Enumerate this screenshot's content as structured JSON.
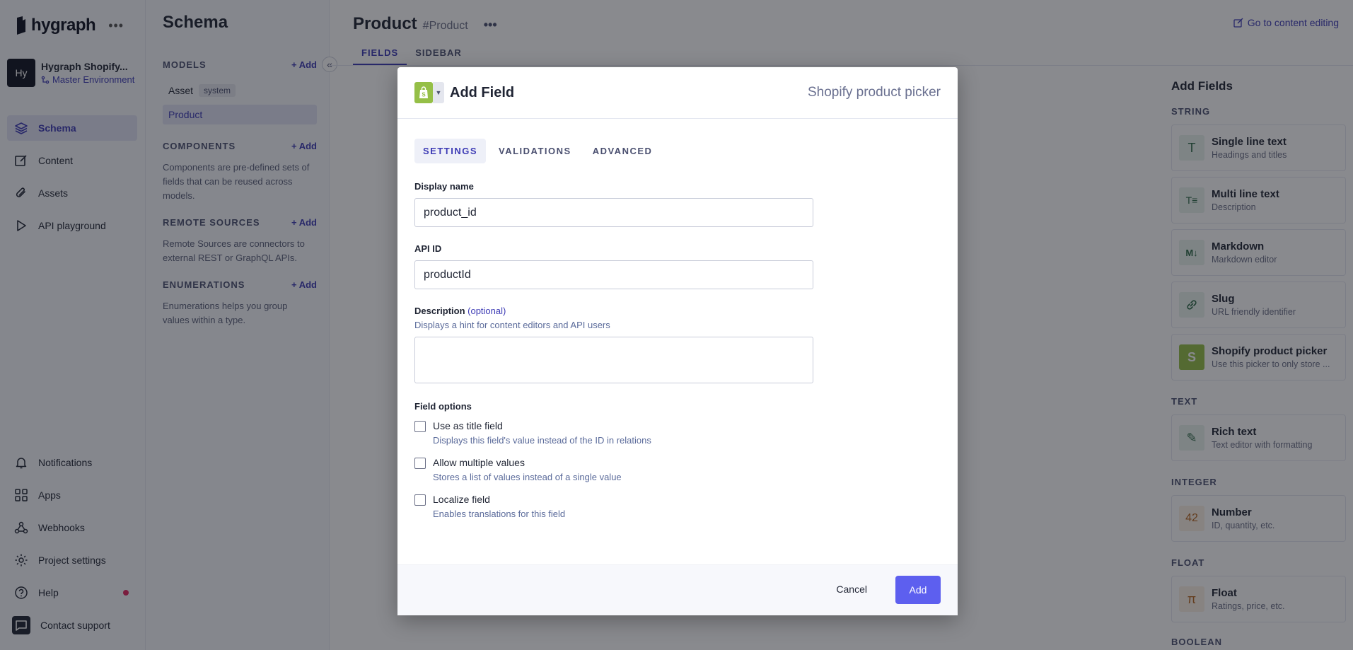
{
  "brand": {
    "name": "hygraph",
    "accent": "#3d3bb5",
    "primary_button": "#5d5fef"
  },
  "project": {
    "initials": "Hy",
    "name": "Hygraph Shopify...",
    "environment": "Master Environment"
  },
  "nav": {
    "primary": [
      {
        "label": "Schema",
        "icon": "layers-icon",
        "active": true
      },
      {
        "label": "Content",
        "icon": "edit-icon"
      },
      {
        "label": "Assets",
        "icon": "paperclip-icon"
      },
      {
        "label": "API playground",
        "icon": "play-icon"
      }
    ],
    "secondary": [
      {
        "label": "Notifications",
        "icon": "bell-icon"
      },
      {
        "label": "Apps",
        "icon": "apps-icon"
      },
      {
        "label": "Webhooks",
        "icon": "webhook-icon"
      },
      {
        "label": "Project settings",
        "icon": "gear-icon"
      },
      {
        "label": "Help",
        "icon": "help-icon"
      },
      {
        "label": "Contact support",
        "icon": "chat-icon"
      }
    ]
  },
  "schema": {
    "title": "Schema",
    "add_label": "Add",
    "models": {
      "heading": "MODELS",
      "asset": "Asset",
      "asset_badge": "system",
      "product": "Product"
    },
    "components": {
      "heading": "COMPONENTS",
      "desc": "Components are pre-defined sets of fields that can be reused across models."
    },
    "remote": {
      "heading": "REMOTE SOURCES",
      "desc": "Remote Sources are connectors to external REST or GraphQL APIs."
    },
    "enums": {
      "heading": "ENUMERATIONS",
      "desc": "Enumerations helps you group values within a type."
    }
  },
  "main": {
    "title": "Product",
    "api_id": "#Product",
    "content_link": "Go to content editing",
    "tabs": [
      "FIELDS",
      "SIDEBAR"
    ]
  },
  "add_fields": {
    "title": "Add Fields",
    "string_heading": "STRING",
    "text_heading": "TEXT",
    "integer_heading": "INTEGER",
    "float_heading": "FLOAT",
    "boolean_heading": "BOOLEAN",
    "items": [
      {
        "name": "Single line text",
        "desc": "Headings and titles",
        "icon_glyph": "T"
      },
      {
        "name": "Multi line text",
        "desc": "Description",
        "icon_glyph": "T≡"
      },
      {
        "name": "Markdown",
        "desc": "Markdown editor",
        "icon_glyph": "M↓"
      },
      {
        "name": "Slug",
        "desc": "URL friendly identifier",
        "icon_glyph": "🔗"
      },
      {
        "name": "Shopify product picker",
        "desc": "Use this picker to only store ...",
        "icon_glyph": "S"
      },
      {
        "name": "Rich text",
        "desc": "Text editor with formatting",
        "icon_glyph": "✎"
      },
      {
        "name": "Number",
        "desc": "ID, quantity, etc.",
        "icon_glyph": "42"
      },
      {
        "name": "Float",
        "desc": "Ratings, price, etc.",
        "icon_glyph": "π"
      }
    ]
  },
  "modal": {
    "title": "Add Field",
    "field_type": "Shopify product picker",
    "tabs": [
      "SETTINGS",
      "VALIDATIONS",
      "ADVANCED"
    ],
    "display_name": {
      "label": "Display name",
      "value": "product_id"
    },
    "api_id": {
      "label": "API ID",
      "value": "productId"
    },
    "description": {
      "label": "Description",
      "optional": "(optional)",
      "hint": "Displays a hint for content editors and API users",
      "value": ""
    },
    "options_heading": "Field options",
    "options": [
      {
        "title": "Use as title field",
        "desc": "Displays this field's value instead of the ID in relations",
        "checked": false
      },
      {
        "title": "Allow multiple values",
        "desc": "Stores a list of values instead of a single value",
        "checked": false
      },
      {
        "title": "Localize field",
        "desc": "Enables translations for this field",
        "checked": false
      }
    ],
    "cancel_label": "Cancel",
    "add_label": "Add"
  }
}
